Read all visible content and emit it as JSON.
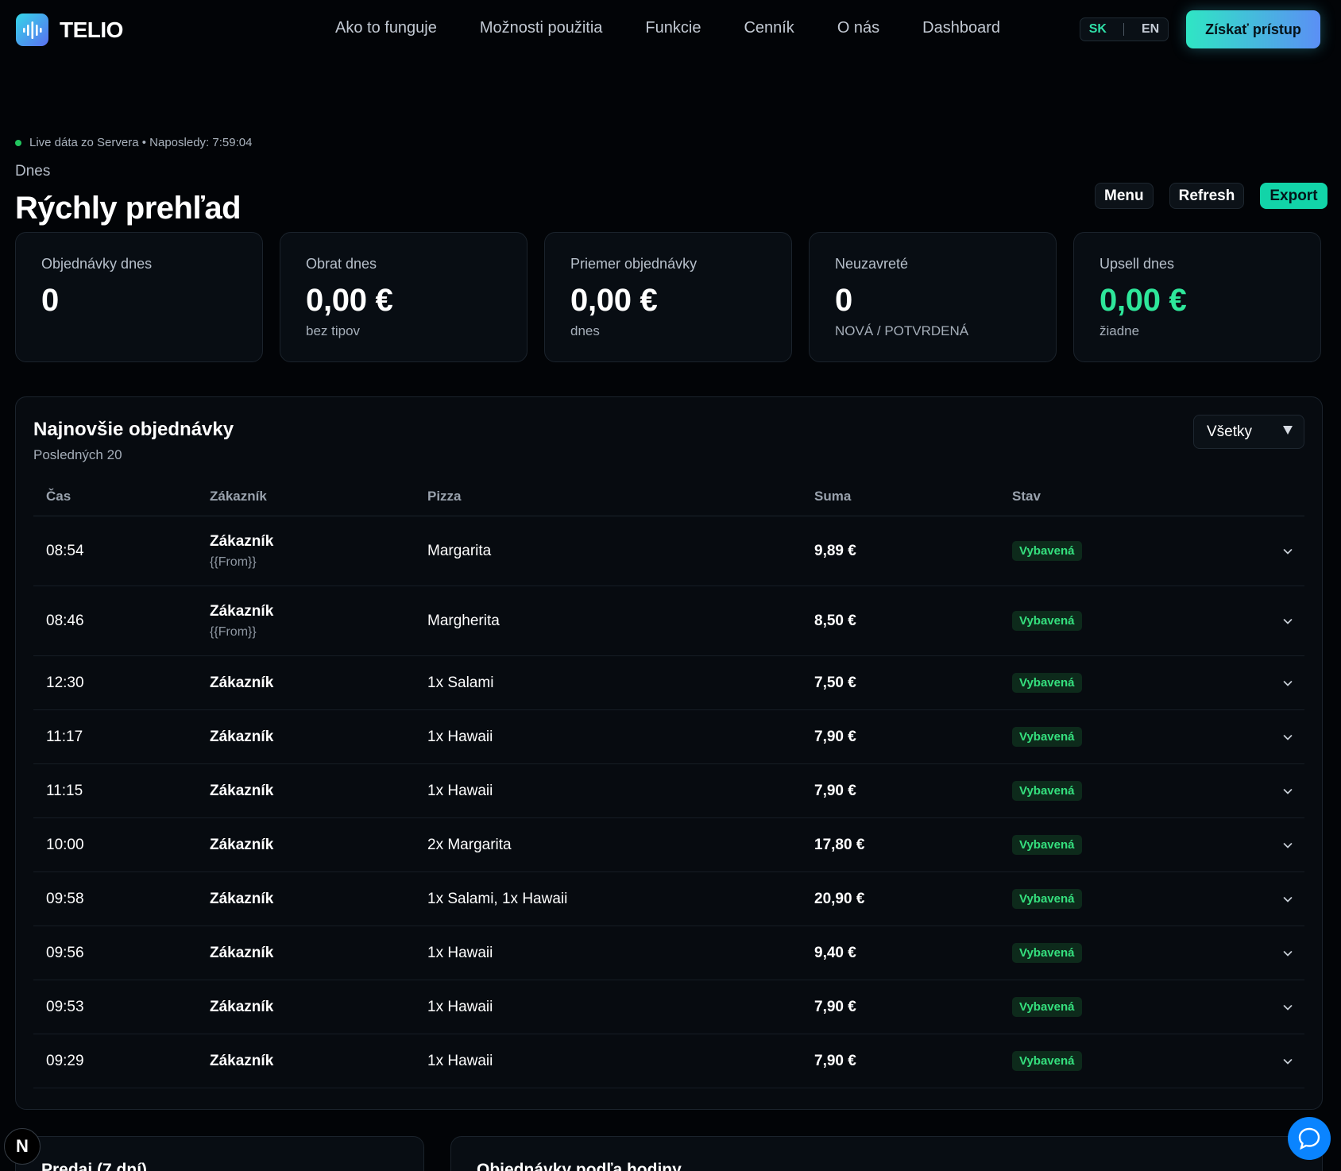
{
  "brand": {
    "name": "TELIO",
    "logo_icon": "sound-wave-icon",
    "accent": "#2fe6c4"
  },
  "nav": {
    "links": [
      "Ako to funguje",
      "Možnosti použitia",
      "Funkcie",
      "Cenník",
      "O nás",
      "Dashboard"
    ],
    "lang_active": "SK",
    "lang_inactive": "EN",
    "cta": "Získať prístup"
  },
  "status": {
    "text": "Live dáta zo Servera • Naposledy: 7:59:04",
    "dot_color": "#22c55e"
  },
  "header": {
    "breadcrumb": "Dnes",
    "title": "Rýchly prehľad"
  },
  "actions": {
    "menu": "Menu",
    "refresh": "Refresh",
    "export": "Export"
  },
  "stats": [
    {
      "label": "Objednávky dnes",
      "value": "0",
      "sub": ""
    },
    {
      "label": "Obrat dnes",
      "value": "0,00 €",
      "sub": "bez tipov"
    },
    {
      "label": "Priemer objednávky",
      "value": "0,00 €",
      "sub": "dnes"
    },
    {
      "label": "Neuzavreté",
      "value": "0",
      "sub": "NOVÁ / POTVRDENÁ"
    },
    {
      "label": "Upsell dnes",
      "value": "0,00 €",
      "sub": "žiadne"
    }
  ],
  "orders": {
    "title": "Najnovšie objednávky",
    "subtitle": "Posledných 20",
    "filter": "Všetky",
    "columns": {
      "time": "Čas",
      "customer": "Zákazník",
      "pizza": "Pizza",
      "sum": "Suma",
      "status": "Stav"
    },
    "rows": [
      {
        "time": "08:54",
        "customer": "Zákazník",
        "from": "{{From}}",
        "pizza": "Margarita",
        "sum": "9,89 €",
        "status": "Vybavená"
      },
      {
        "time": "08:46",
        "customer": "Zákazník",
        "from": "{{From}}",
        "pizza": "Margherita",
        "sum": "8,50 €",
        "status": "Vybavená"
      },
      {
        "time": "12:30",
        "customer": "Zákazník",
        "from": "",
        "pizza": "1x Salami",
        "sum": "7,50 €",
        "status": "Vybavená"
      },
      {
        "time": "11:17",
        "customer": "Zákazník",
        "from": "",
        "pizza": "1x Hawaii",
        "sum": "7,90 €",
        "status": "Vybavená"
      },
      {
        "time": "11:15",
        "customer": "Zákazník",
        "from": "",
        "pizza": "1x Hawaii",
        "sum": "7,90 €",
        "status": "Vybavená"
      },
      {
        "time": "10:00",
        "customer": "Zákazník",
        "from": "",
        "pizza": "2x Margarita",
        "sum": "17,80 €",
        "status": "Vybavená"
      },
      {
        "time": "09:58",
        "customer": "Zákazník",
        "from": "",
        "pizza": "1x Salami, 1x Hawaii",
        "sum": "20,90 €",
        "status": "Vybavená"
      },
      {
        "time": "09:56",
        "customer": "Zákazník",
        "from": "",
        "pizza": "1x Hawaii",
        "sum": "9,40 €",
        "status": "Vybavená"
      },
      {
        "time": "09:53",
        "customer": "Zákazník",
        "from": "",
        "pizza": "1x Hawaii",
        "sum": "7,90 €",
        "status": "Vybavená"
      },
      {
        "time": "09:29",
        "customer": "Zákazník",
        "from": "",
        "pizza": "1x Hawaii",
        "sum": "7,90 €",
        "status": "Vybavená"
      }
    ]
  },
  "bottom": {
    "sales_title": "Predaj (7 dní)",
    "hourly_title": "Objednávky podľa hodiny"
  },
  "floating": {
    "next_badge": "N",
    "chat_icon": "chat-bubble-icon"
  }
}
